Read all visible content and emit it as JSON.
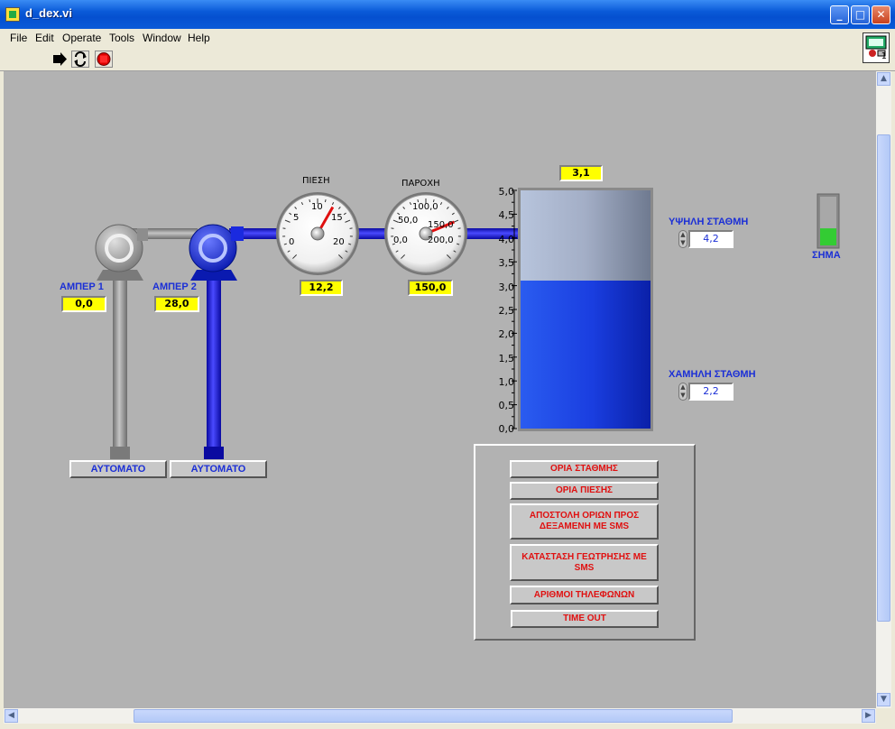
{
  "window": {
    "title": "d_dex.vi",
    "min": "_",
    "max": "□",
    "close": "✕"
  },
  "menu": [
    "File",
    "Edit",
    "Operate",
    "Tools",
    "Window",
    "Help"
  ],
  "vi_icon_number": "1",
  "pumps": [
    {
      "label": "ΑΜΠΕΡ  1",
      "value": "0,0",
      "mode": "ΑΥΤΟΜΑΤΟ",
      "color": "#8a8a8a"
    },
    {
      "label": "ΑΜΠΕΡ  2",
      "value": "28,0",
      "mode": "ΑΥΤΟΜΑΤΟ",
      "color": "#1a1adf"
    }
  ],
  "pressure_gauge": {
    "label": "ΠΙΕΣΗ",
    "ticks": [
      "0",
      "5",
      "10",
      "15",
      "20"
    ],
    "min": 0,
    "max": 20,
    "value": 12.2,
    "readout": "12,2"
  },
  "flow_gauge": {
    "label": "ΠΑΡΟΧΗ",
    "ticks": [
      "0,0",
      "50,0",
      "100,0",
      "150,0",
      "200,0"
    ],
    "min": 0,
    "max": 200,
    "value": 150.0,
    "readout": "150,0"
  },
  "tank": {
    "readout": "3,1",
    "min": 0,
    "max": 5,
    "level": 3.1,
    "scale": [
      "5,0",
      "4,5",
      "4,0",
      "3,5",
      "3,0",
      "2,5",
      "2,0",
      "1,5",
      "1,0",
      "0,5",
      "0,0"
    ]
  },
  "high_level": {
    "label": "ΥΨΗΛΗ ΣΤΑΘΜΗ",
    "value": "4,2"
  },
  "low_level": {
    "label": "ΧΑΜΗΛΗ ΣΤΑΘΜΗ",
    "value": "2,2"
  },
  "signal": {
    "label": "ΣΗΜΑ",
    "level": 0.35
  },
  "buttons": {
    "level_limits": "ΟΡΙΑ ΣΤΑΘΜΗΣ",
    "pressure_limits": "ΟΡΙΑ ΠΙΕΣΗΣ",
    "send_limits": "ΑΠΟΣΤΟΛΗ ΟΡΙΩΝ ΠΡΟΣ ΔΕΞΑΜΕΝΗ ΜΕ SMS",
    "drill_status": "ΚΑΤΑΣΤΑΣΗ ΓΕΩΤΡΗΣΗΣ ΜΕ SMS",
    "phone_numbers": "ΑΡΙΘΜΟΙ ΤΗΛΕΦΩΝΩΝ",
    "time_out": "TIME OUT"
  },
  "colors": {
    "pipe_blue": "#1a1adf",
    "pipe_gray": "#8a8a8a",
    "readout": "#ffff00",
    "panel": "#b2b2b2",
    "label_blue": "#1b2fd6",
    "button_red": "#e01010"
  }
}
